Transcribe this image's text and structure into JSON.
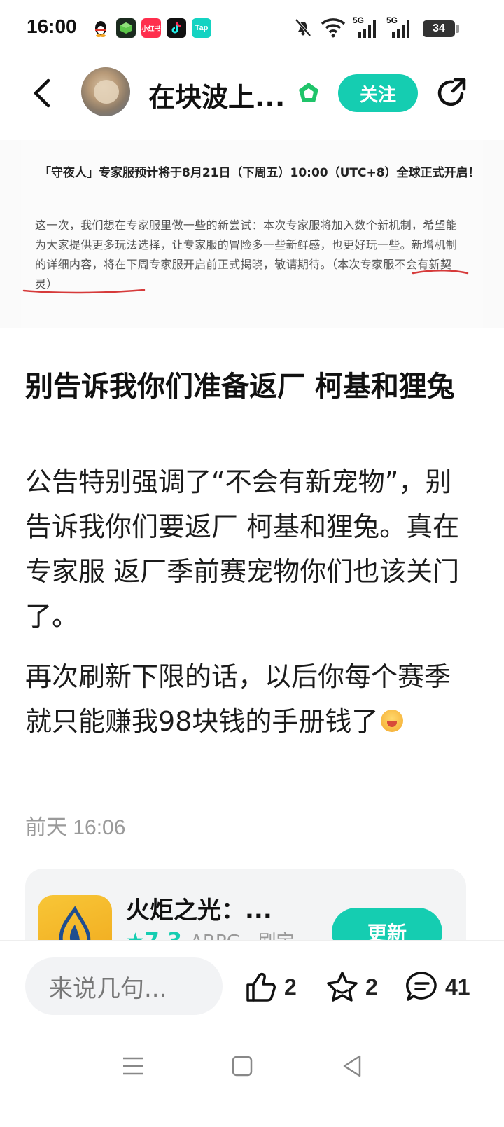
{
  "status_bar": {
    "time": "16:00",
    "battery": "34",
    "signal_label_1": "5G",
    "signal_label_2": "5G",
    "notification_apps": [
      "qq-icon",
      "cube-app-icon",
      "xiaohongshu-icon",
      "tiktok-icon",
      "taptap-icon"
    ],
    "notification_labels": {
      "xiaohongshu": "小红书",
      "taptap": "Tap"
    }
  },
  "header": {
    "title": "在块波上...",
    "follow_label": "关注"
  },
  "announcement": {
    "title": "「守夜人」专家服预计将于8月21日（下周五）10:00（UTC+8）全球正式开启！",
    "body_main": "这一次，我们想在专家服里做一些的新尝试：本次专家服将加入数个新机制，希望能为大家提供更多玩法选择，让专家服的冒险多一些新鲜感，也更好玩一些。新增机制的详细内容，将在下周专家服开启前正式揭晓，敬请期待。",
    "body_highlight": "（本次专家服不会有新契灵）"
  },
  "post": {
    "title": "别告诉我你们准备返厂 柯基和狸兔",
    "paragraph_1": "公告特别强调了“不会有新宠物”，别告诉我你们要返厂 柯基和狸兔。真在专家服 返厂季前赛宠物你们也该关门了。",
    "paragraph_2": "再次刷新下限的话，以后你每个赛季就只能赚我98块钱的手册钱了",
    "time": "前天 16:06"
  },
  "game_card": {
    "name": "火炬之光：...",
    "rating": "★7.3",
    "tags": "ARPG · 刷宝",
    "update_label": "更新"
  },
  "action_bar": {
    "comment_placeholder": "来说几句...",
    "like_count": "2",
    "favorite_count": "2",
    "comment_count": "41"
  },
  "colors": {
    "accent": "#15cdb1",
    "verified": "#1fc46a",
    "underline": "#d63a3a"
  }
}
